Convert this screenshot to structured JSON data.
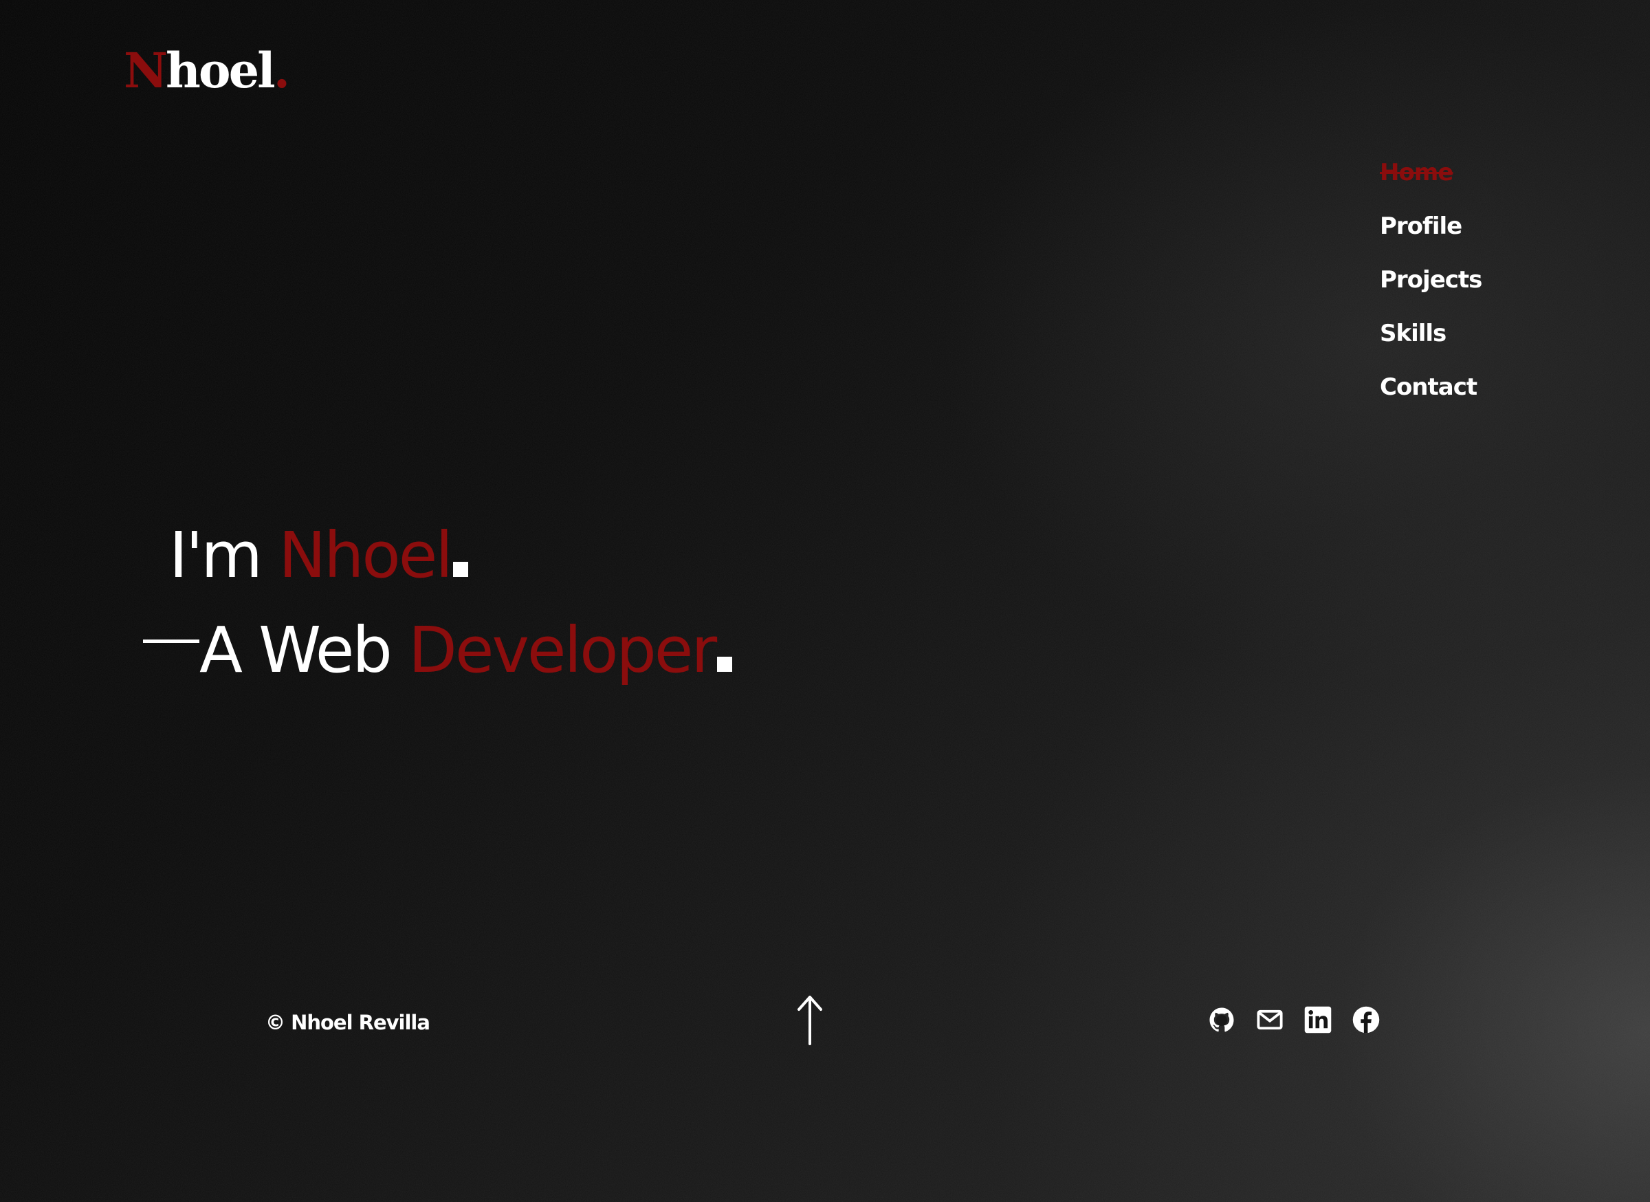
{
  "logo": {
    "first_letter": "N",
    "rest": "hoel",
    "dot": "."
  },
  "nav": {
    "items": [
      {
        "label": "Home",
        "active": true
      },
      {
        "label": "Profile",
        "active": false
      },
      {
        "label": "Projects",
        "active": false
      },
      {
        "label": "Skills",
        "active": false
      },
      {
        "label": "Contact",
        "active": false
      }
    ]
  },
  "hero": {
    "line1_prefix": "I'm",
    "line1_name": "Nhoel",
    "line2_prefix": "A Web",
    "line2_role": "Developer"
  },
  "footer": {
    "copyright": "© Nhoel Revilla",
    "scroll_top_icon": "arrow-up-icon",
    "socials": [
      "github-icon",
      "mail-icon",
      "linkedin-icon",
      "facebook-icon"
    ]
  },
  "colors": {
    "accent": "#8b0d0d",
    "text": "#ffffff",
    "background": "#0b0b0b"
  }
}
